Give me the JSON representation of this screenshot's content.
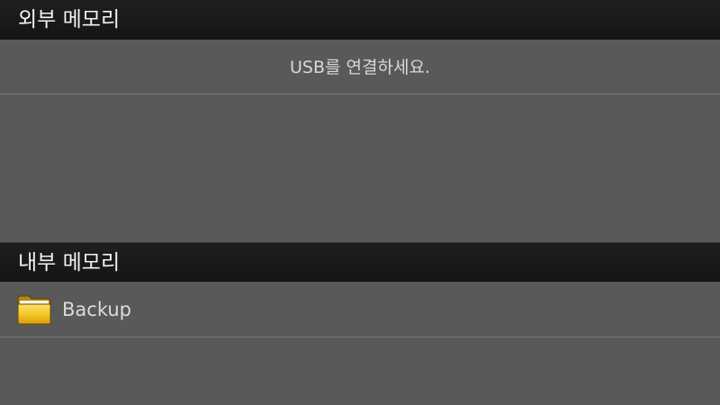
{
  "external": {
    "header": "외부 메모리",
    "message": "USB를 연결하세요."
  },
  "internal": {
    "header": "내부 메모리",
    "items": [
      {
        "label": "Backup",
        "icon": "folder-icon"
      }
    ]
  },
  "colors": {
    "background": "#595959",
    "header_bg": "#17181a",
    "folder": "#e8b81c"
  }
}
